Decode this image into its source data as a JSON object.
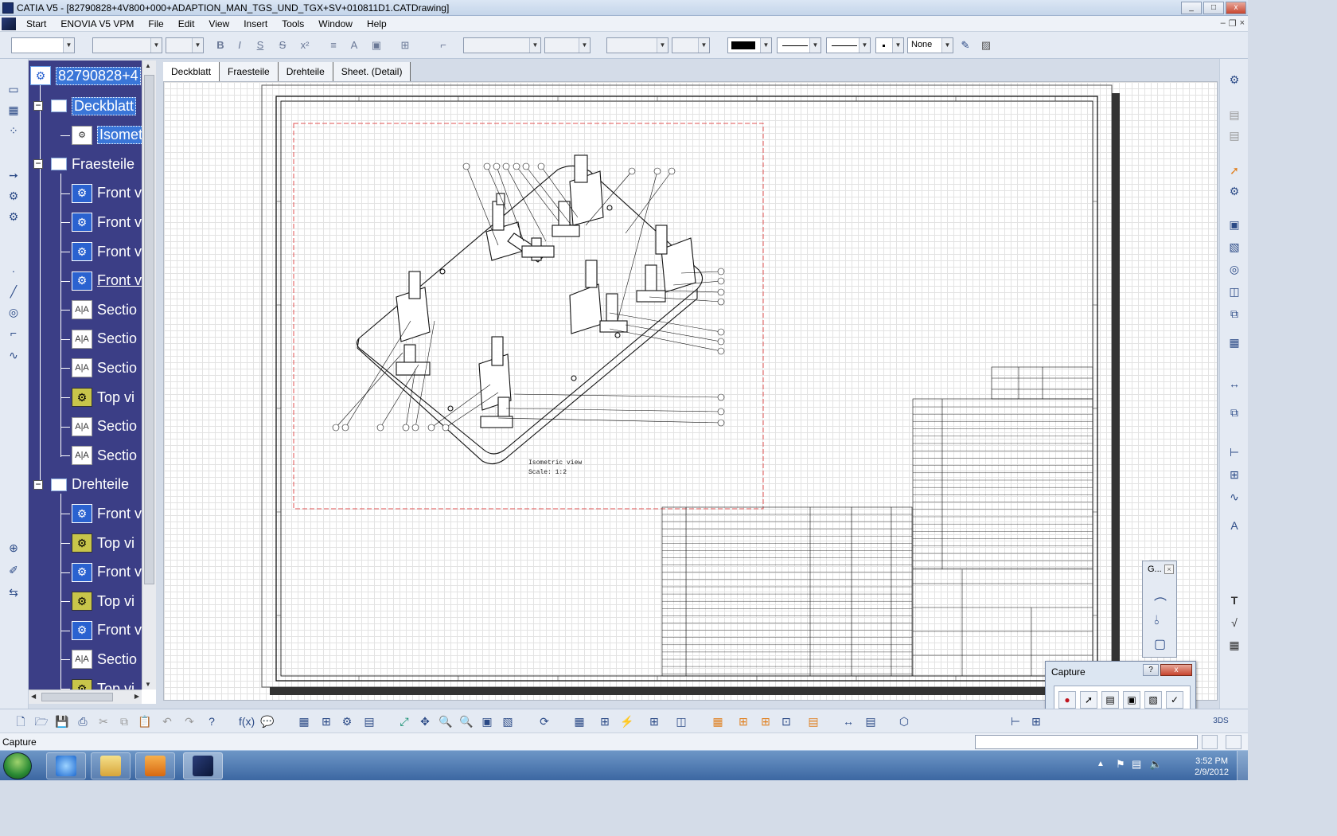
{
  "window": {
    "title": "CATIA V5 - [82790828+4V800+000+ADAPTION_MAN_TGS_UND_TGX+SV+010811D1.CATDrawing]",
    "controls": [
      "_",
      "□",
      "x"
    ]
  },
  "menubar": {
    "items": [
      "Start",
      "ENOVIA V5 VPM",
      "File",
      "Edit",
      "View",
      "Insert",
      "Tools",
      "Window",
      "Help"
    ]
  },
  "toolbar": {
    "line_type_value": "None"
  },
  "tree": {
    "root_label": "82790828+4",
    "nodes": [
      {
        "label": "Deckblatt",
        "kind": "sheet"
      },
      {
        "label": "Isomet",
        "kind": "view"
      },
      {
        "label": "Fraesteile",
        "kind": "sheet"
      },
      {
        "label": "Front v",
        "kind": "view"
      },
      {
        "label": "Front v",
        "kind": "view"
      },
      {
        "label": "Front v",
        "kind": "view"
      },
      {
        "label": "Front v",
        "kind": "view"
      },
      {
        "label": "Sectio",
        "kind": "section"
      },
      {
        "label": "Sectio",
        "kind": "section"
      },
      {
        "label": "Sectio",
        "kind": "section"
      },
      {
        "label": "Top vi",
        "kind": "top"
      },
      {
        "label": "Sectio",
        "kind": "section"
      },
      {
        "label": "Sectio",
        "kind": "section"
      },
      {
        "label": "Drehteile",
        "kind": "sheet"
      },
      {
        "label": "Front v",
        "kind": "view"
      },
      {
        "label": "Top vi",
        "kind": "top"
      },
      {
        "label": "Front v",
        "kind": "view"
      },
      {
        "label": "Top vi",
        "kind": "top"
      },
      {
        "label": "Front v",
        "kind": "view"
      },
      {
        "label": "Sectio",
        "kind": "section"
      },
      {
        "label": "Top vi",
        "kind": "top"
      }
    ]
  },
  "sheet_tabs": [
    "Deckblatt",
    "Fraesteile",
    "Drehteile",
    "Sheet. (Detail)"
  ],
  "drawing": {
    "view_caption": "Isometric view",
    "view_scale": "Scale: 1:2"
  },
  "gpanel": {
    "title": "G..."
  },
  "capture": {
    "title": "Capture",
    "help": "?",
    "close": "x"
  },
  "statusbar": {
    "text": "Capture"
  },
  "taskbar": {
    "time": "3:52 PM",
    "date": "2/9/2012"
  },
  "colors": {
    "tree_bg": "#3b3e86",
    "selection": "#3a76d8",
    "view_frame": "#e05050"
  }
}
